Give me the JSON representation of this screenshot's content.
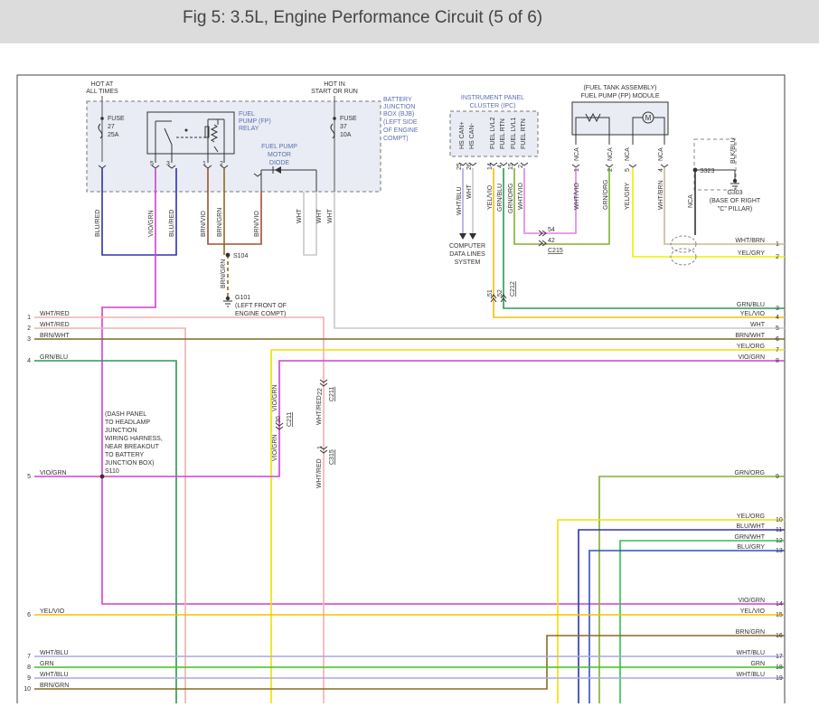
{
  "header": {
    "title": "Fig 5: 3.5L, Engine Performance Circuit (5 of 6)"
  },
  "power": {
    "hot_all_times": [
      "HOT AT",
      "ALL TIMES"
    ],
    "hot_in_start_run": [
      "HOT IN",
      "START OR RUN"
    ],
    "fuse27": [
      "FUSE",
      "27",
      "25A"
    ],
    "fuse37": [
      "FUSE",
      "37",
      "10A"
    ]
  },
  "bjb_label": [
    "BATTERY",
    "JUNCTION",
    "BOX (BJB)",
    "(LEFT SIDE",
    "OF ENGINE",
    "COMPT)"
  ],
  "relay_label": [
    "FUEL",
    "PUMP (FP)",
    "RELAY"
  ],
  "relay_pins": [
    "5",
    "3",
    "1",
    "2"
  ],
  "diode_label": [
    "FUEL PUMP",
    "MOTOR",
    "DIODE"
  ],
  "bjb_wires": [
    "BLU/RED",
    "VIO/GRN",
    "BLU/RED",
    "BRN/VIO",
    "BRN/GRN",
    "BRN/VIO",
    "WHT",
    "WHT",
    "WHT"
  ],
  "splice_s104": "S104",
  "s104_wire": "BRN/GRN",
  "g101_label": [
    "G101",
    "(LEFT FRONT OF",
    "ENGINE COMPT)"
  ],
  "ipc": {
    "title": [
      "INSTRUMENT PANEL",
      "CLUSTER (IPC)"
    ],
    "pin_names": [
      "HS CAN+",
      "HS CAN-",
      "FUEL LVL2",
      "FUEL RTN",
      "FUEL LVL1",
      "FUEL RTN"
    ],
    "pin_numbers": [
      "25",
      "26",
      "14",
      "4",
      "15",
      "2"
    ],
    "wires": [
      "WHT/BLU",
      "WHT",
      "YEL/VIO",
      "GRN/BLU",
      "GRN/ORG",
      "WHT/VIO"
    ],
    "network": [
      "COMPUTER",
      "DATA LINES",
      "SYSTEM"
    ]
  },
  "fp_module": {
    "title": [
      "(FUEL TANK ASSEMBLY)",
      "FUEL PUMP (FP) MODULE"
    ],
    "motor": "M",
    "pin_nca": [
      "NCA",
      "NCA",
      "NCA",
      "NCA"
    ],
    "pin_numbers": [
      "1",
      "2",
      "5",
      "4"
    ],
    "wires": [
      "WHT/VIO",
      "GRN/ORG",
      "YEL/GRY",
      "WHT/BRN"
    ]
  },
  "s323": "S323",
  "ground_nca": "NCA",
  "ground_wire": "BLK/BLU",
  "g303_label": [
    "G303",
    "(BASE OF RIGHT",
    "\"C\" PILLAR)"
  ],
  "connectors": {
    "c215": "C215",
    "c215_pins": [
      "54",
      "42"
    ],
    "c212": "C212",
    "c212_pins": [
      "51",
      "52"
    ],
    "c211": "C211",
    "c211_pin_a": "30",
    "c211_pin_b": "22",
    "c315": "C315",
    "c315_pin": "1"
  },
  "vertical_labels": {
    "v1": "VIO/GRN",
    "v2": "VIO/GRN",
    "v3": "WHT/RED",
    "v4": "WHT/RED"
  },
  "s110_label": [
    "(DASH PANEL",
    "TO HEADLAMP",
    "JUNCTION",
    "WIRING HARNESS,",
    "NEAR BREAKOUT",
    "TO BATTERY",
    "JUNCTION BOX)",
    "S110"
  ],
  "left_wires": [
    {
      "num": "1",
      "color": "WHT/RED"
    },
    {
      "num": "2",
      "color": "WHT/RED"
    },
    {
      "num": "3",
      "color": "BRN/WHT"
    },
    {
      "num": "4",
      "color": "GRN/BLU"
    },
    {
      "num": "5",
      "color": "VIO/GRN"
    },
    {
      "num": "6",
      "color": "YEL/VIO"
    },
    {
      "num": "7",
      "color": "WHT/BLU"
    },
    {
      "num": "8",
      "color": "GRN"
    },
    {
      "num": "9",
      "color": "WHT/BLU"
    },
    {
      "num": "10",
      "color": "BRN/GRN"
    }
  ],
  "right_wires": [
    {
      "num": "1",
      "color": "WHT/BRN"
    },
    {
      "num": "2",
      "color": "YEL/GRY"
    },
    {
      "num": "3",
      "color": "GRN/BLU"
    },
    {
      "num": "4",
      "color": "YEL/VIO"
    },
    {
      "num": "5",
      "color": "WHT"
    },
    {
      "num": "6",
      "color": "BRN/WHT"
    },
    {
      "num": "7",
      "color": "YEL/ORG"
    },
    {
      "num": "8",
      "color": "VIO/GRN"
    },
    {
      "num": "9",
      "color": "GRN/ORG"
    },
    {
      "num": "10",
      "color": "YEL/ORG"
    },
    {
      "num": "11",
      "color": "BLU/WHT"
    },
    {
      "num": "12",
      "color": "GRN/WHT"
    },
    {
      "num": "13",
      "color": "BLU/GRY"
    },
    {
      "num": "14",
      "color": "VIO/GRN"
    },
    {
      "num": "15",
      "color": "YEL/VIO"
    },
    {
      "num": "16",
      "color": "BRN/GRN"
    },
    {
      "num": "17",
      "color": "WHT/BLU"
    },
    {
      "num": "18",
      "color": "GRN"
    },
    {
      "num": "19",
      "color": "WHT/BLU"
    }
  ],
  "wire_colors": {
    "blu_red": "#3030b0",
    "vio_grn": "#d040d0",
    "brn": "#a05030",
    "brn_grn": "#8a6a20",
    "wht": "#c8c8c8",
    "wht_red": "#f0b0b0",
    "brn_wht": "#7a6a20",
    "grn_blu": "#2a9a50",
    "yel_vio": "#f5c000",
    "wht_blu": "#a8a8e0",
    "grn": "#40c020",
    "grn_org": "#80b030",
    "yel_org": "#f0e000",
    "blu_wht": "#3030b0",
    "grn_wht": "#30c050",
    "blu_gry": "#3050c0",
    "yel_gry": "#f0f000",
    "wht_brn": "#c8b898",
    "wht_vio": "#e080e0",
    "brn_vio": "#a05030",
    "text": "#333333",
    "label_blue": "#5a6fb0"
  }
}
